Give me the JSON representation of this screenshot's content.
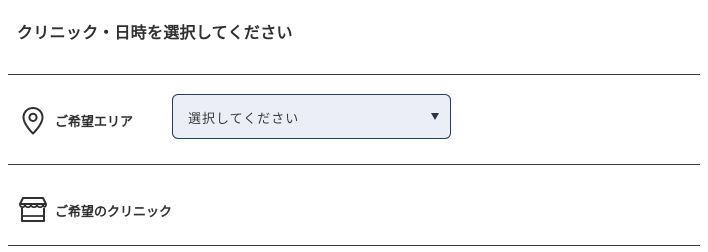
{
  "form": {
    "title": "クリニック・日時を選択してください",
    "area": {
      "icon": "map-pin-icon",
      "label": "ご希望エリア",
      "select": {
        "value": "選択してください"
      }
    },
    "clinic": {
      "icon": "storefront-icon",
      "label": "ご希望のクリニック"
    }
  },
  "colors": {
    "select_background": "#eceef7",
    "select_border": "#2e3a4f",
    "divider": "#3a3a3a",
    "text": "#2f2f2f"
  }
}
